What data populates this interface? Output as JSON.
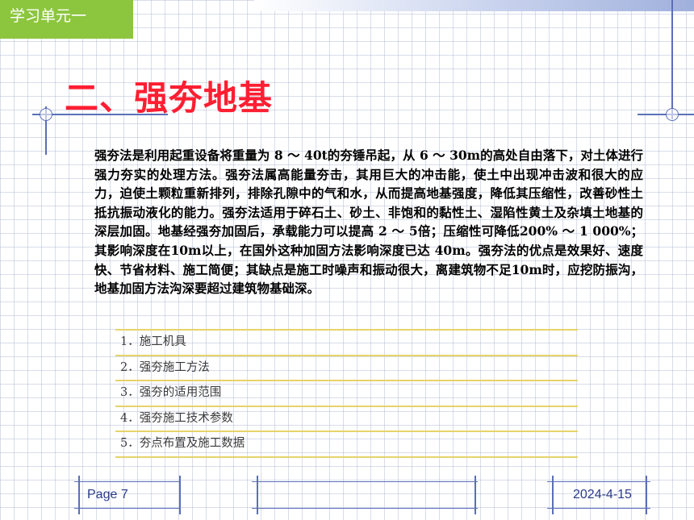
{
  "header": {
    "unit_label": "学习单元一"
  },
  "slide": {
    "title": "二、强夯地基",
    "paragraph": "强夯法是利用起重设备将重量为 8 ～ 40t的夯锤吊起，从 6 ～ 30m的高处自由落下，对土体进行强力夯实的处理方法。强夯法属高能量夯击，其用巨大的冲击能，使土中出现冲击波和很大的应力，迫使土颗粒重新排列，排除孔隙中的气和水，从而提高地基强度，降低其压缩性，改善砂性土抵抗振动液化的能力。强夯法适用于碎石土、砂土、非饱和的黏性土、湿陷性黄土及杂填土地基的深层加固。地基经强夯加固后，承载能力可以提高 2 ～ 5倍；压缩性可降低200% ～ 1 000%；其影响深度在10m以上，在国外这种加固方法影响深度已达 40m。强夯法的优点是效果好、速度快、节省材料、施工简便；其缺点是施工时噪声和振动很大，离建筑物不足10m时，应挖防振沟，地基加固方法沟深要超过建筑物基础深。",
    "items": [
      "1．施工机具",
      "2．强夯施工方法",
      "3．强夯的适用范围",
      "4．强夯施工技术参数",
      "5．夯点布置及施工数据"
    ]
  },
  "footer": {
    "page": "Page 7",
    "date": "2024-4-15"
  },
  "colors": {
    "tab_green": "#8cc63f",
    "title_red": "#ff1e32",
    "accent_blue": "#5b6fb8",
    "list_rule_yellow": "#e6d36a"
  }
}
